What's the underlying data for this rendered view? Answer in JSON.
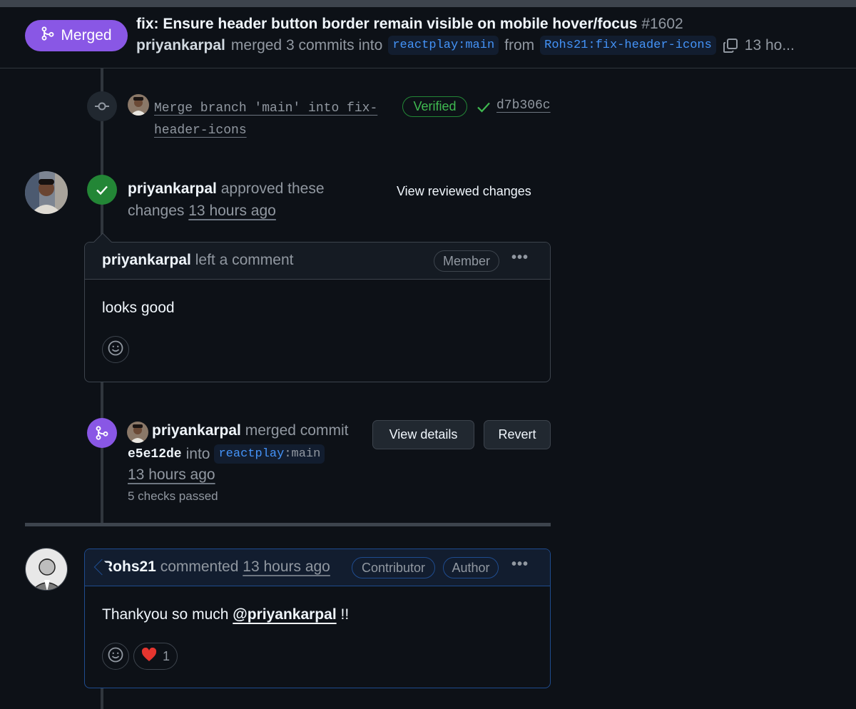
{
  "header": {
    "status": "Merged",
    "title": "fix: Ensure header button border remain visible on mobile hover/focus",
    "number": "#1602",
    "author": "priyankarpal",
    "merged_text": "merged 3 commits into",
    "base_branch": "reactplay:main",
    "from_text": "from",
    "head_branch": "Rohs21:fix-header-icons",
    "time_truncated": "13 ho..."
  },
  "commit": {
    "message_line1": "Merge branch 'main' into fix-",
    "message_line2": "header-icons",
    "verified": "Verified",
    "sha": "d7b306c"
  },
  "review": {
    "reviewer": "priyankarpal",
    "action_line1": "approved these",
    "action_line2_prefix": "changes",
    "time": "13 hours ago",
    "view_button": "View reviewed changes"
  },
  "review_comment": {
    "author": "priyankarpal",
    "action": "left a comment",
    "badge": "Member",
    "body": "looks good"
  },
  "merge_event": {
    "author": "priyankarpal",
    "action": "merged commit",
    "sha": "e5e12de",
    "into": "into",
    "branch_owner": "reactplay",
    "branch_name": ":main",
    "time": "13 hours ago",
    "checks": "5 checks passed",
    "details_button": "View details",
    "revert_button": "Revert"
  },
  "author_comment": {
    "author": "Rohs21",
    "action": "commented",
    "time": "13 hours ago",
    "badge_contributor": "Contributor",
    "badge_author": "Author",
    "body_prefix": "Thankyou so much",
    "mention": "@priyankarpal",
    "body_suffix": "!!",
    "reaction_count": "1"
  },
  "colors": {
    "merged_purple": "#8957e5",
    "approved_green": "#238636",
    "link_blue": "#4493f8"
  }
}
